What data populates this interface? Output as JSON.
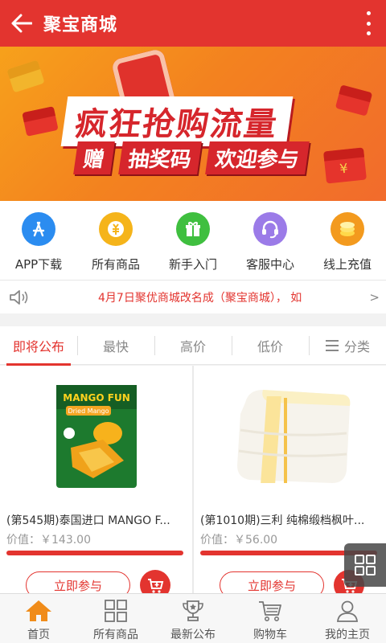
{
  "topbar": {
    "title": "聚宝商城"
  },
  "banner": {
    "headline": "疯狂抢购流量",
    "sub_tags": [
      "赠",
      "抽奖码",
      "欢迎参与"
    ],
    "env_symbol": "¥",
    "slide_count": 5,
    "active_slide": 2
  },
  "quick_links": [
    {
      "label": "APP下载",
      "icon": "app-store-icon",
      "color": "#2b8cf0"
    },
    {
      "label": "所有商品",
      "icon": "money-bag-icon",
      "color": "#f5b41a"
    },
    {
      "label": "新手入门",
      "icon": "gift-icon",
      "color": "#3fbf3f"
    },
    {
      "label": "客服中心",
      "icon": "headset-icon",
      "color": "#9b7be8"
    },
    {
      "label": "线上充值",
      "icon": "coins-icon",
      "color": "#f39a1e"
    }
  ],
  "notice": {
    "text": "4月7日聚优商城改名成（聚宝商城），  如",
    "arrow": ">"
  },
  "tabs": [
    {
      "label": "即将公布",
      "active": true
    },
    {
      "label": "最快",
      "active": false
    },
    {
      "label": "高价",
      "active": false
    },
    {
      "label": "低价",
      "active": false
    },
    {
      "label": "分类",
      "active": false
    }
  ],
  "products": [
    {
      "title": "(第545期)泰国进口 MANGO F...",
      "value": "价值：￥143.00",
      "progress": 1.0,
      "button": "立即参与",
      "pack_brand": "MANGO FUN",
      "pack_sub": "Dried Mango"
    },
    {
      "title": "(第1010期)三利 纯棉缎档枫叶...",
      "value": "价值：￥56.00",
      "progress": 1.0,
      "button": "立即参与"
    }
  ],
  "bottom_nav": [
    {
      "label": "首页",
      "icon": "home-icon",
      "active": true
    },
    {
      "label": "所有商品",
      "icon": "grid-icon",
      "active": false
    },
    {
      "label": "最新公布",
      "icon": "trophy-icon",
      "active": false
    },
    {
      "label": "购物车",
      "icon": "cart-icon",
      "active": false
    },
    {
      "label": "我的主页",
      "icon": "user-icon",
      "active": false
    }
  ],
  "colors": {
    "primary": "#e3342f",
    "banner_orange": "#f3821f",
    "home_active": "#f08c1a"
  }
}
